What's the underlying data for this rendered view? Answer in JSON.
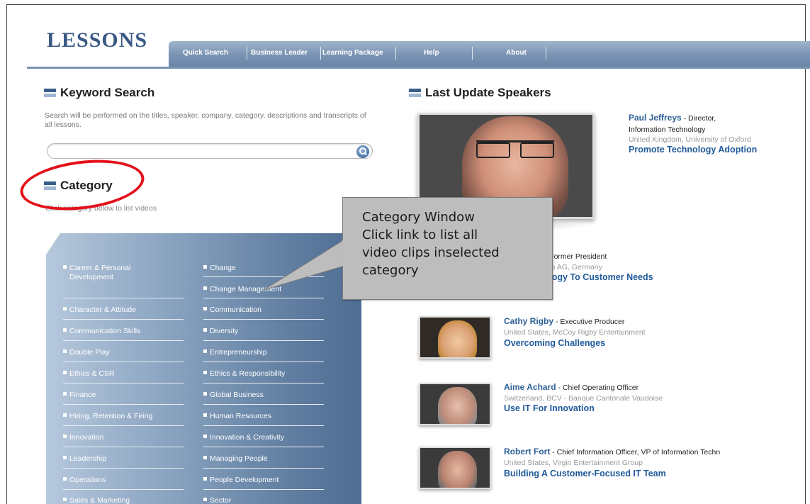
{
  "logo": "LESSONS",
  "nav": {
    "items": [
      "Quick Search",
      "Business Leader",
      "Learning Package",
      "Help",
      "About"
    ]
  },
  "keyword_search": {
    "title": "Keyword Search",
    "description": "Search will be performed on the titles, speaker, company, category, descriptions and transcripts of all lessons.",
    "placeholder": ""
  },
  "category": {
    "title": "Category",
    "description": "Click category below to list videos",
    "left_items": [
      "Career & Personal Development",
      "Character & Attitude",
      "Communication Skills",
      "Double Play",
      "Ethics & CSR",
      "Finance",
      "Hiring, Retention & Firing",
      "Innovation",
      "Leadership",
      "Operations",
      "Sales & Marketing"
    ],
    "right_items": [
      "Change",
      "Change Management",
      "Communication",
      "Diversity",
      "Entrepreneurship",
      "Ethics & Responsibility",
      "Global Business",
      "Human Resources",
      "Innovation & Creativity",
      "Managing People",
      "People Development",
      "Sector"
    ]
  },
  "callout": {
    "lines": [
      "Category Window",
      "Click link to list all",
      "video clips inselected",
      "category"
    ]
  },
  "speakers": {
    "title": "Last Update Speakers",
    "featured": {
      "name": "Paul Jeffreys",
      "role_line1": " - Director,",
      "role_line2": "Information Technology",
      "location": "United Kingdom, University of Oxford",
      "lesson": "Promote Technology Adoption"
    },
    "partial": {
      "role": "n - Former President",
      "location": "agen AG, Germany",
      "lesson": "nology To Customer Needs"
    },
    "list": [
      {
        "name": "Cathy Rigby",
        "role": " - Executive Producer",
        "location": "United States, McCoy Rigby Entertainment",
        "lesson": "Overcoming Challenges"
      },
      {
        "name": "Aime Achard",
        "role": " - Chief Operating Officer",
        "location": "Switzerland, BCV - Banque Cantonale Vaudoise",
        "lesson": "Use IT For Innovation"
      },
      {
        "name": "Robert Fort",
        "role": " - Chief Information Officer, VP of Information Techn",
        "location": "United States, Virgin Entertainment Group",
        "lesson": "Building A Customer-Focused IT Team"
      }
    ]
  }
}
